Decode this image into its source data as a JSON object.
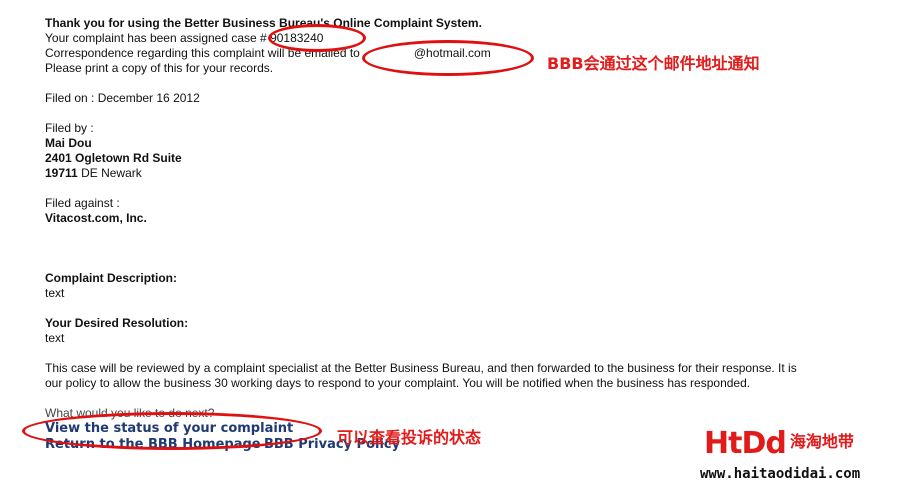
{
  "header": {
    "thanks": "Thank you for using the Better Business Bureau's Online Complaint System.",
    "assigned_prefix": "Your complaint has been assigned case #",
    "case_number": "90183240",
    "correspondence_prefix": "Correspondence regarding this complaint will be emailed to",
    "email_visible": "@hotmail.com",
    "print_note": "Please print a copy of this for your records."
  },
  "filed_on": "Filed on : December 16 2012",
  "filed_by": {
    "label": "Filed by :",
    "name": "Mai Dou",
    "address1": "2401 Ogletown Rd Suite",
    "zip": "19711",
    "city_state": "DE Newark"
  },
  "filed_against": {
    "label": "Filed against :",
    "company": "Vitacost.com, Inc."
  },
  "complaint": {
    "label": "Complaint Description:",
    "text": "text"
  },
  "resolution": {
    "label": "Your Desired Resolution:",
    "text": "text"
  },
  "review_paragraph": "This case will be reviewed by a complaint specialist at the Better Business Bureau, and then forwarded to the business for their response. It is our policy to allow the business 30 working days to respond to your complaint. You will be notified when the business has responded.",
  "next": {
    "question": "What would you like to do next?",
    "view_status": "View the status of your complaint",
    "return_home": "Return to the BBB Homepage",
    "privacy": "BBB Privacy Policy"
  },
  "annotations": {
    "email_note": "BBB会通过这个邮件地址通知",
    "status_note": "可以查看投诉的状态"
  },
  "watermark": {
    "brand": "HtDd",
    "brand_cn": "海淘地带",
    "url": "www.haitaodidai.com"
  },
  "colors": {
    "annotation_red": "#e31b1b",
    "link_blue": "#1f3a73"
  }
}
